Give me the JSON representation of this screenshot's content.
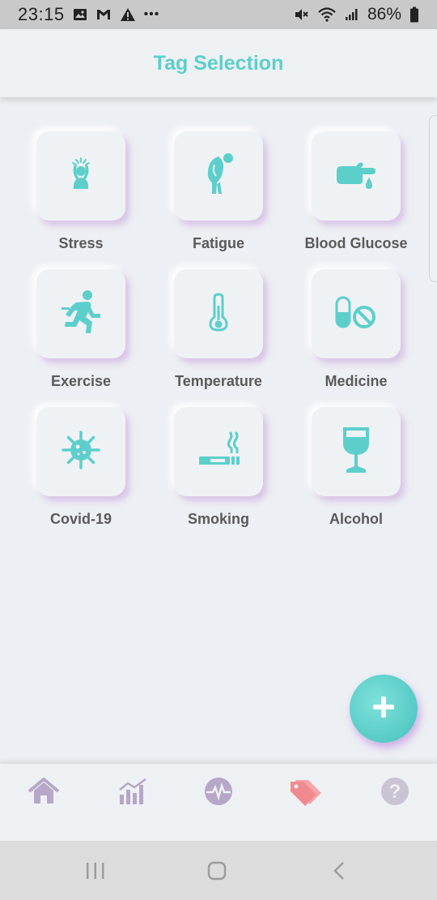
{
  "status_bar": {
    "time": "23:15",
    "overflow": "•••",
    "battery_percent": "86%",
    "icons": [
      "image-icon",
      "gmail-icon",
      "warning-icon",
      "mute-icon",
      "wifi-icon",
      "signal-icon",
      "battery-icon"
    ]
  },
  "header": {
    "title": "Tag Selection"
  },
  "tags": [
    {
      "label": "Stress",
      "icon": "stress-icon"
    },
    {
      "label": "Fatigue",
      "icon": "fatigue-icon"
    },
    {
      "label": "Blood Glucose",
      "icon": "blood-glucose-icon"
    },
    {
      "label": "Exercise",
      "icon": "running-icon"
    },
    {
      "label": "Temperature",
      "icon": "thermometer-icon"
    },
    {
      "label": "Medicine",
      "icon": "pill-icon"
    },
    {
      "label": "Covid-19",
      "icon": "virus-icon"
    },
    {
      "label": "Smoking",
      "icon": "cigarette-icon"
    },
    {
      "label": "Alcohol",
      "icon": "wine-glass-icon"
    }
  ],
  "fab": {
    "icon": "plus-icon"
  },
  "bottom_nav": {
    "items": [
      {
        "icon": "home-icon"
      },
      {
        "icon": "chart-icon"
      },
      {
        "icon": "heartbeat-icon"
      },
      {
        "icon": "tags-icon",
        "active": true
      },
      {
        "icon": "help-icon"
      }
    ]
  },
  "colors": {
    "accent": "#5ccfcb",
    "nav_inactive": "#b6a7c9",
    "nav_active": "#f08a8f",
    "background": "#eceff3"
  }
}
